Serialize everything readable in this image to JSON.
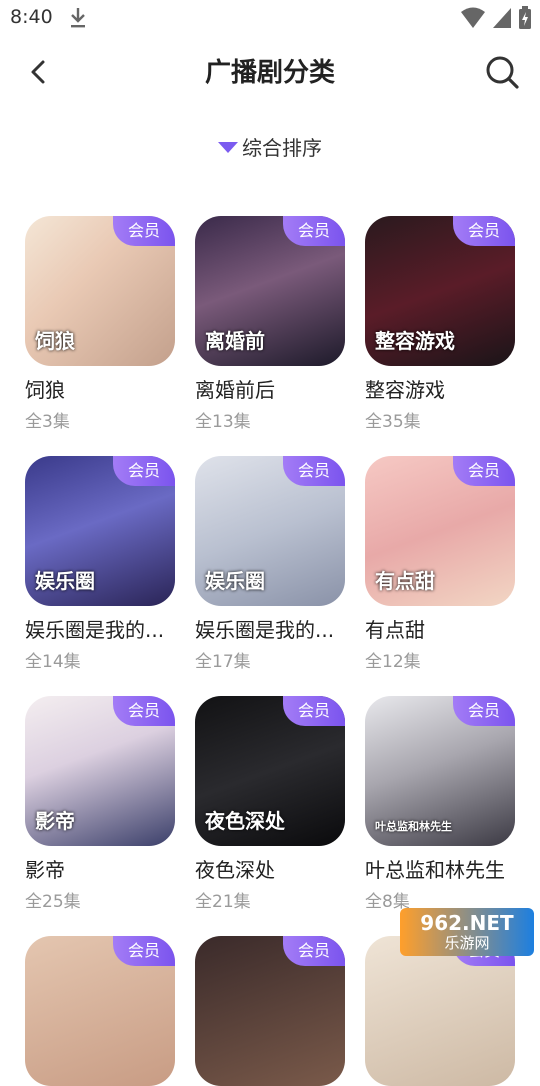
{
  "status": {
    "time": "8:40"
  },
  "header": {
    "title": "广播剧分类"
  },
  "sort": {
    "label": "综合排序"
  },
  "badge_label": "会员",
  "items": [
    {
      "title": "饲狼",
      "count": "全3集",
      "bg": "linear-gradient(135deg,#f4e6d6 0%,#e9c9b4 40%,#c3a08c 100%)",
      "art": "饲狼"
    },
    {
      "title": "离婚前后",
      "count": "全13集",
      "bg": "linear-gradient(160deg,#3a2a4a 0%,#7a5a7a 45%,#1d1a2a 100%)",
      "art": "离婚前"
    },
    {
      "title": "整容游戏",
      "count": "全35集",
      "bg": "linear-gradient(160deg,#2a1a1e 0%,#5a1c28 50%,#1a1418 100%)",
      "art": "整容游戏"
    },
    {
      "title": "娱乐圈是我的...",
      "count": "全14集",
      "bg": "linear-gradient(160deg,#3a3a8a 0%,#6a6ac4 45%,#2a2456 100%)",
      "art": "娱乐圈"
    },
    {
      "title": "娱乐圈是我的...",
      "count": "全17集",
      "bg": "linear-gradient(160deg,#dfe2ea 0%,#b9c0d0 50%,#8a92a8 100%)",
      "art": "娱乐圈"
    },
    {
      "title": "有点甜",
      "count": "全12集",
      "bg": "linear-gradient(160deg,#f6c9c4 0%,#e8a9a8 50%,#f2d6c4 100%)",
      "art": "有点甜"
    },
    {
      "title": "影帝",
      "count": "全25集",
      "bg": "linear-gradient(160deg,#f4eef0 0%,#dcd0e0 40%,#3b3f6a 100%)",
      "art": "影帝"
    },
    {
      "title": "夜色深处",
      "count": "全21集",
      "bg": "linear-gradient(160deg,#121214 0%,#2a2a2e 50%,#0a0a0c 100%)",
      "art": "夜色深处"
    },
    {
      "title": "叶总监和林先生",
      "count": "全8集",
      "bg": "linear-gradient(160deg,#e8e8ec 0%,#a8a6ae 45%,#3c3a44 100%)",
      "art": "叶总监和林先生"
    }
  ],
  "partial_items": [
    {
      "bg": "linear-gradient(160deg,#e4c6b0 0%,#c89c84 100%)"
    },
    {
      "bg": "linear-gradient(160deg,#3a2a2a 0%,#7a5a4a 100%)"
    },
    {
      "bg": "linear-gradient(160deg,#efe4d6 0%,#cdb9a4 100%)"
    }
  ],
  "watermark": {
    "brand": "962.NET",
    "sub": "乐游网"
  },
  "colors": {
    "accent": "#7b54ee",
    "badge_start": "#a37cf6"
  }
}
